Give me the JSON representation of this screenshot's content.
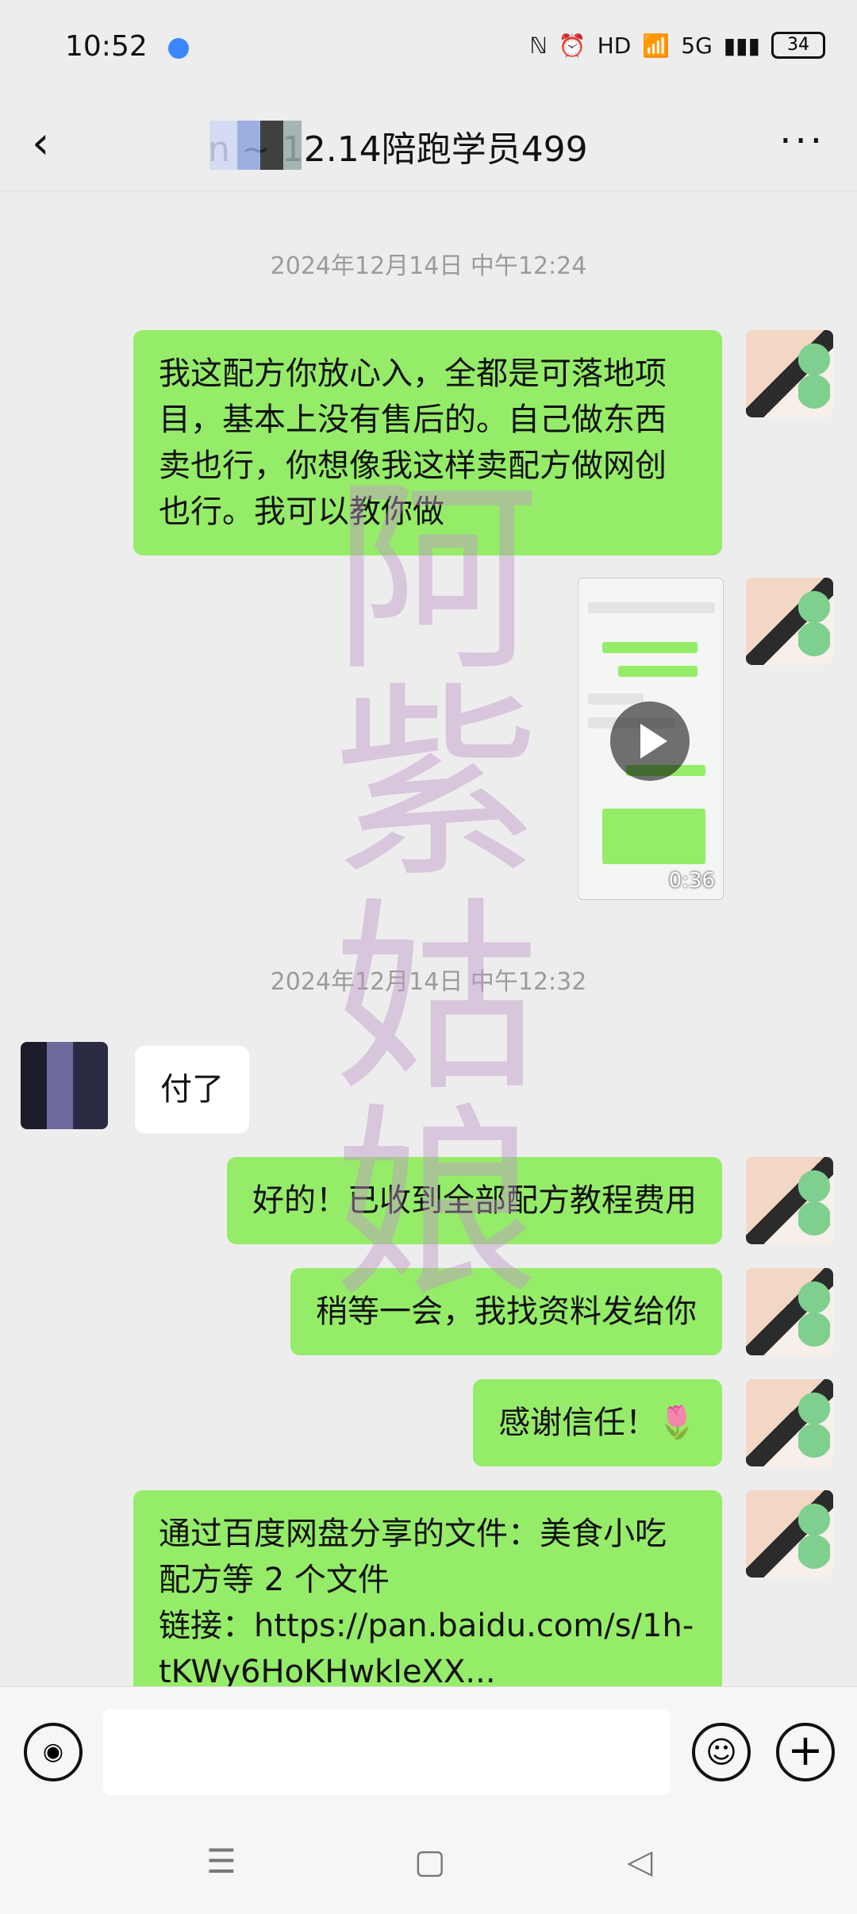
{
  "status": {
    "time": "10:52",
    "icons": [
      "ℕ",
      "⏰",
      "HD",
      "📶",
      "5G",
      "▮▮▮"
    ],
    "battery": "34"
  },
  "header": {
    "title": "n ~ 12.14陪跑学员499",
    "back_icon": "chevron-left-icon",
    "more_icon": "more-icon"
  },
  "messages": [
    {
      "type": "timestamp",
      "text": "2024年12月14日 中午12:24"
    },
    {
      "type": "text",
      "side": "right",
      "text": "我这配方你放心入，全都是可落地项目，基本上没有售后的。自己做东西卖也行，你想像我这样卖配方做网创也行。我可以教你做"
    },
    {
      "type": "video",
      "side": "right",
      "duration": "0:36"
    },
    {
      "type": "timestamp",
      "text": "2024年12月14日 中午12:32"
    },
    {
      "type": "text",
      "side": "left",
      "text": "付了"
    },
    {
      "type": "text",
      "side": "right",
      "text": "好的！已收到全部配方教程费用"
    },
    {
      "type": "text",
      "side": "right",
      "text": "稍等一会，我找资料发给你"
    },
    {
      "type": "text",
      "side": "right",
      "text": "感谢信任！🌷"
    },
    {
      "type": "text",
      "side": "right",
      "text": "通过百度网盘分享的文件：美食小吃配方等 2 个文件\n链接：https://pan.baidu.com/s/1h-tKWy6HoKHwkIeXX..."
    }
  ],
  "watermark": [
    "阿",
    "紫",
    "姑",
    "娘"
  ],
  "input": {
    "placeholder": ""
  },
  "navbar": {
    "menu": "☰",
    "home": "▢",
    "back": "◁"
  }
}
